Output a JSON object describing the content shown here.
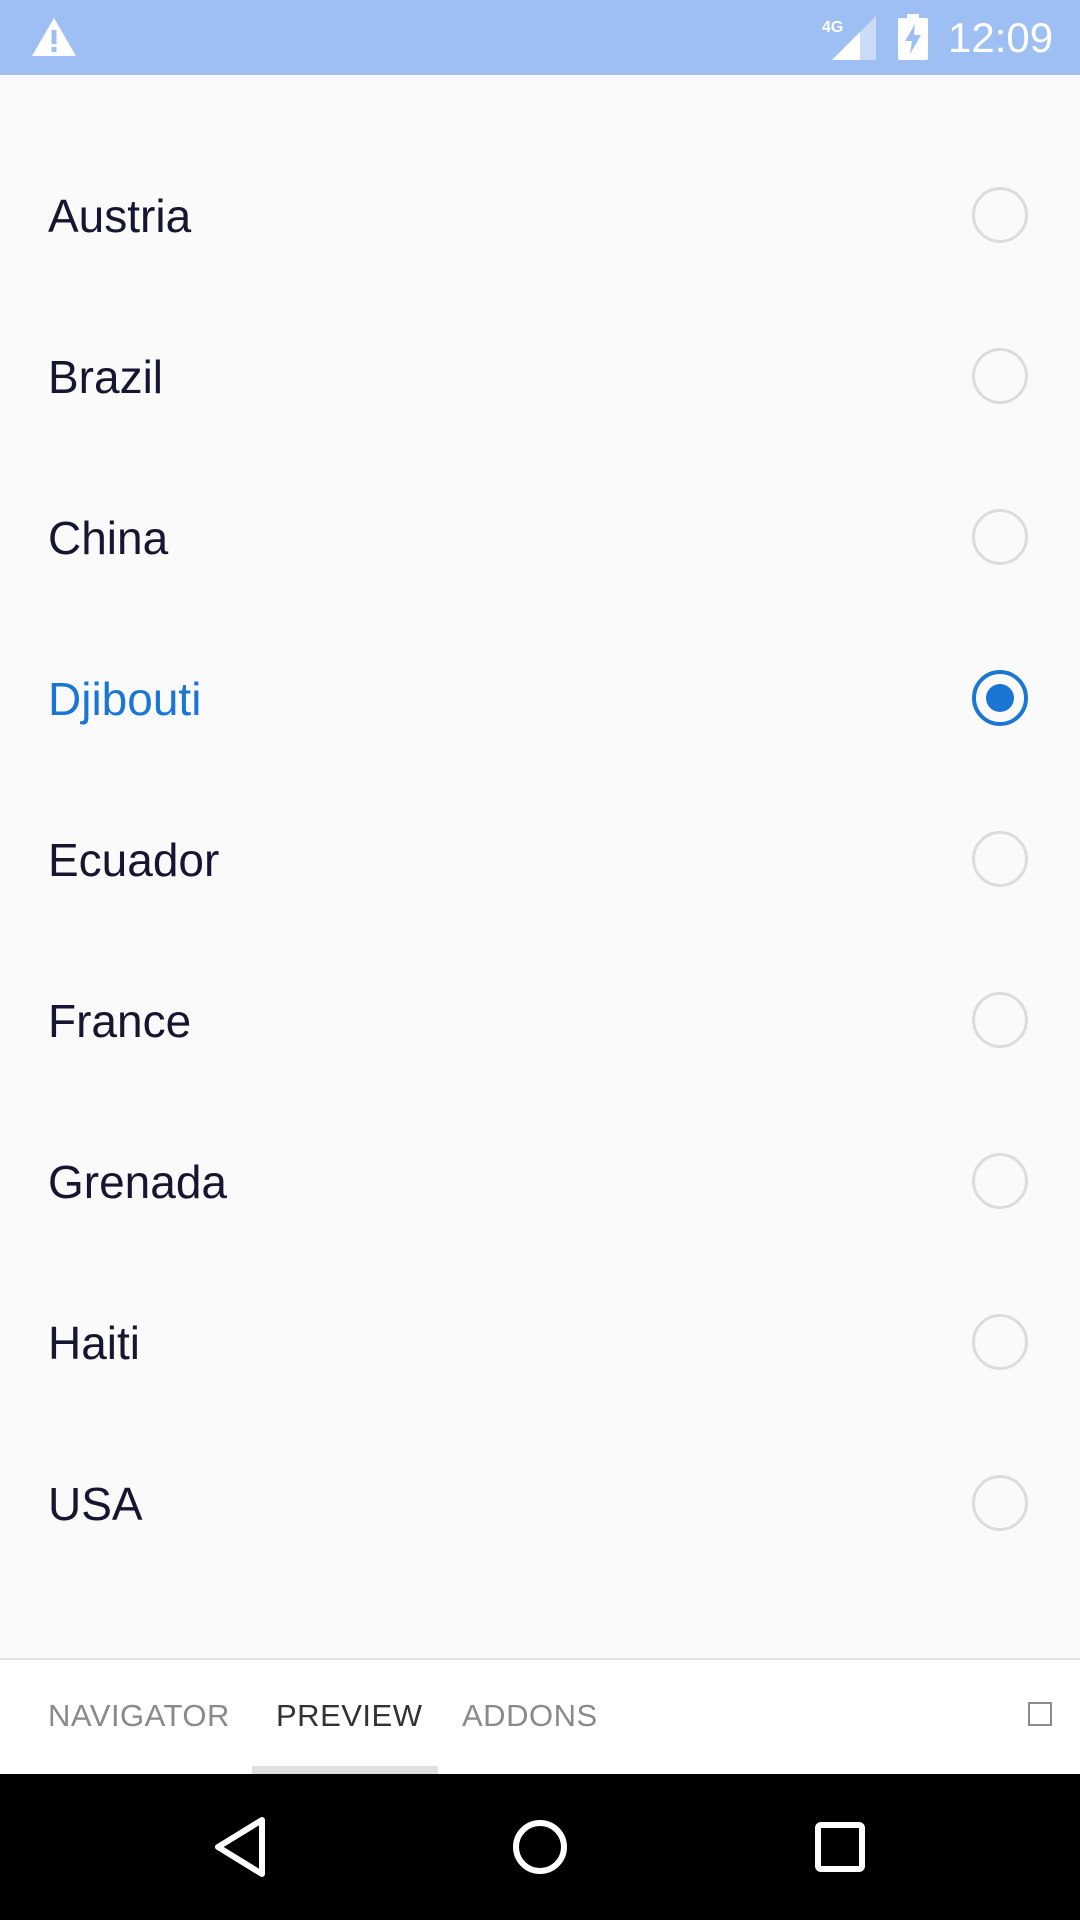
{
  "status_bar": {
    "time": "12:09",
    "network": "4G",
    "icons": [
      "warning-icon",
      "signal-icon",
      "battery-charging-icon"
    ],
    "background": "#9ebff3"
  },
  "countries": {
    "items": [
      {
        "label": "Austria",
        "selected": false
      },
      {
        "label": "Brazil",
        "selected": false
      },
      {
        "label": "China",
        "selected": false
      },
      {
        "label": "Djibouti",
        "selected": true
      },
      {
        "label": "Ecuador",
        "selected": false
      },
      {
        "label": "France",
        "selected": false
      },
      {
        "label": "Grenada",
        "selected": false
      },
      {
        "label": "Haiti",
        "selected": false
      },
      {
        "label": "USA",
        "selected": false
      }
    ],
    "accent_color": "#1976d2",
    "text_color": "#161630"
  },
  "tabs": {
    "items": [
      {
        "label": "NAVIGATOR",
        "active": false
      },
      {
        "label": "PREVIEW",
        "active": true
      },
      {
        "label": "ADDONS",
        "active": false
      }
    ]
  },
  "nav_bar": {
    "icons": [
      "back-icon",
      "home-icon",
      "recents-icon"
    ]
  }
}
